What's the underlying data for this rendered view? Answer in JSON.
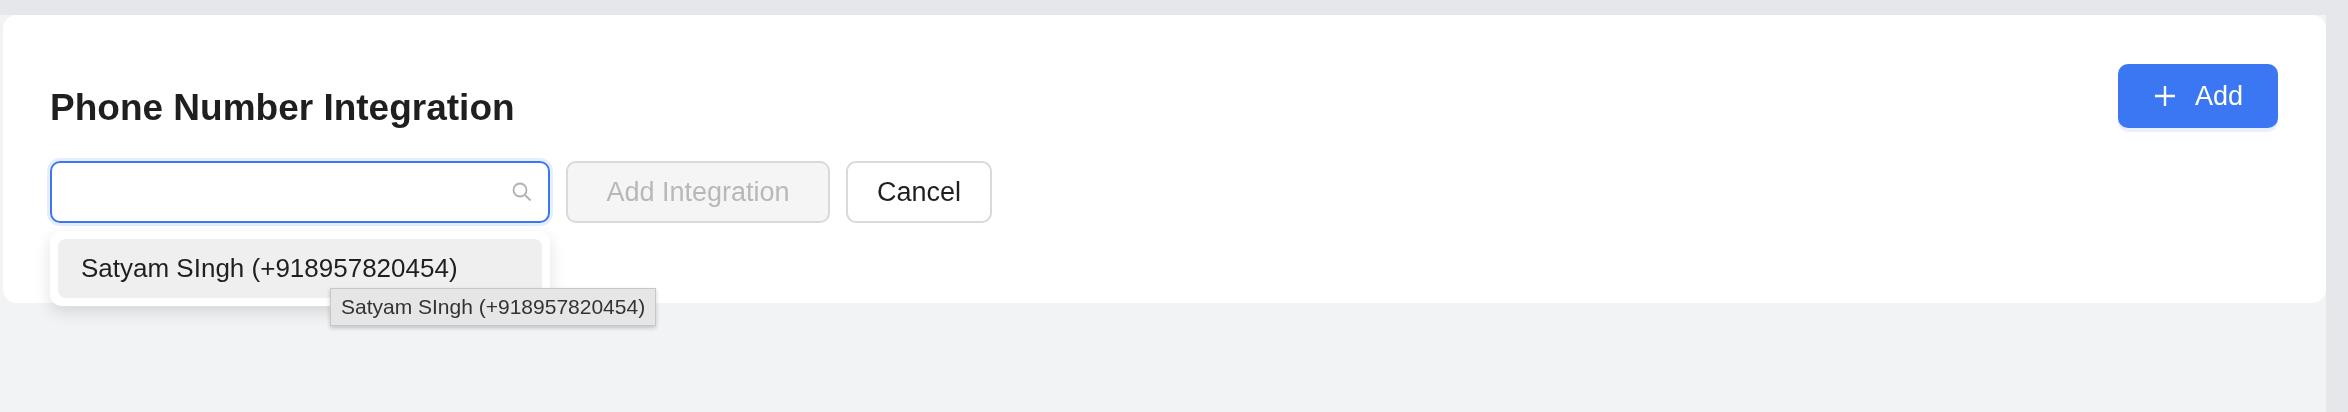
{
  "title": "Phone Number Integration",
  "add_button": {
    "label": "Add"
  },
  "search": {
    "focused": true
  },
  "add_integration_button": {
    "label": "Add Integration",
    "disabled": true
  },
  "cancel_button": {
    "label": "Cancel"
  },
  "dropdown": {
    "options": [
      {
        "label": "Satyam SIngh (+918957820454)",
        "selected": true
      }
    ]
  },
  "tooltip": "Satyam SIngh (+918957820454)"
}
